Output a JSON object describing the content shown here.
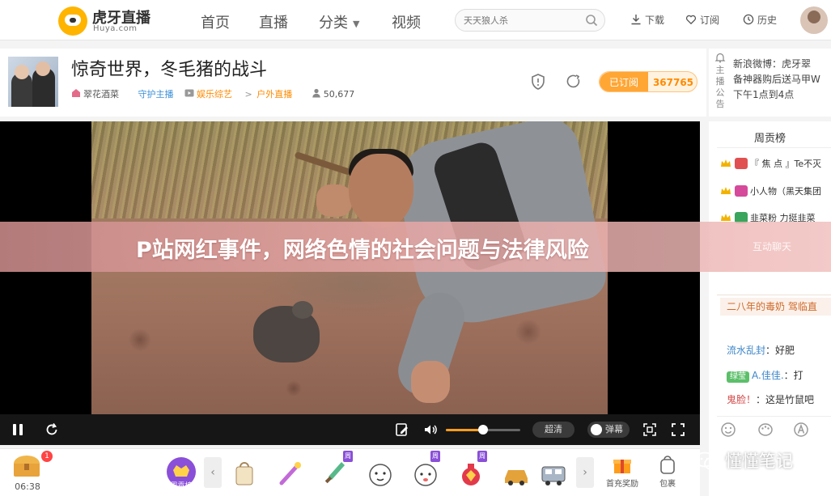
{
  "nav": {
    "logo_name": "虎牙直播",
    "logo_sub": "Huya.com",
    "items": [
      {
        "label": "首页"
      },
      {
        "label": "直播"
      },
      {
        "label": "分类"
      },
      {
        "label": "视频"
      }
    ],
    "search_placeholder": "天天狼人杀",
    "tools": [
      {
        "label": "下载",
        "icon": "download-icon"
      },
      {
        "label": "订阅",
        "icon": "heart-icon"
      },
      {
        "label": "历史",
        "icon": "clock-icon"
      }
    ]
  },
  "room": {
    "title": "惊奇世界，冬毛猪的战斗",
    "host": "翠花酒菜",
    "guard": "守护主播",
    "category_1": "娱乐综艺",
    "category_sep": ">",
    "category_2": "户外直播",
    "viewers": "50,677",
    "subscribe_label": "已订阅",
    "subscribe_count": "367765"
  },
  "announce": {
    "label": "主播公告",
    "lines": [
      "新浪微博：虎牙翠",
      "备神器购后送马甲W",
      "下午1点到4点"
    ]
  },
  "player": {
    "quality": "超清",
    "danmu": "弹幕"
  },
  "rank": {
    "title": "周贡榜",
    "rows": [
      {
        "text": "『 焦 点 』Te不灭",
        "crown_color": "#f2b300",
        "badge_color": "#e05050"
      },
      {
        "text": "小人物（黑天集团",
        "crown_color": "#f2b300",
        "badge_color": "#d54a9a"
      },
      {
        "text": "韭菜粉 力挺韭菜",
        "crown_color": "#f2b300",
        "badge_color": "#3aa55c"
      }
    ]
  },
  "chat": {
    "highlight": "二八年的毒奶 驾临直",
    "messages": [
      {
        "nick": "流水乱封",
        "sep": "：",
        "text": "好肥"
      },
      {
        "badge": "绿莹",
        "nick": "A.佳佳.",
        "sep": "：",
        "text": "打"
      },
      {
        "nick": "鬼脸！",
        "sep": "：",
        "text": "这是竹鼠吧"
      }
    ]
  },
  "giftbar": {
    "chest_count": "1",
    "chest_time": "06:38",
    "fan_label": "周贡榜",
    "gift_tag": "周",
    "recharge_label": "首充奖励",
    "bag_label": "包裹"
  },
  "banner": {
    "headline": "P站网红事件，网络色情的社会问题与法律风险",
    "side_text": "互动聊天"
  },
  "watermark": {
    "text": "懂懂笔记"
  },
  "colors": {
    "brand_orange": "#ff9d1a",
    "link_blue": "#3d86c8",
    "banner_pink": "#e8aaa8"
  }
}
